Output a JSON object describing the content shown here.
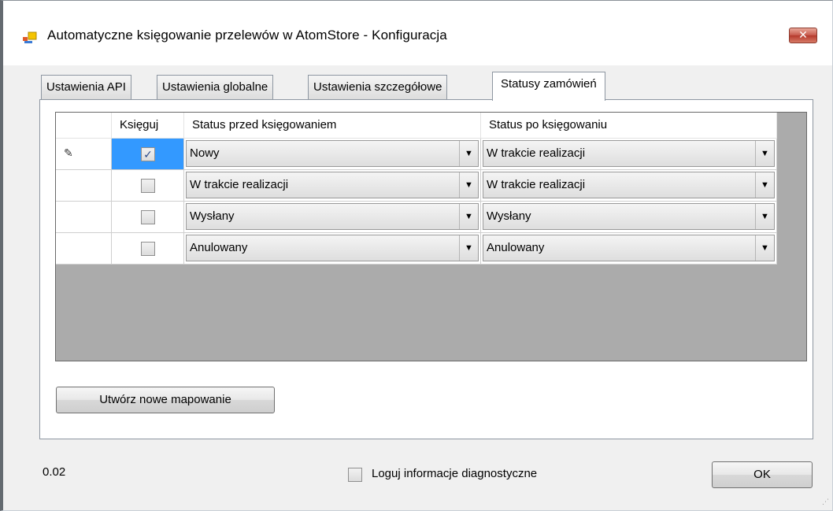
{
  "window": {
    "title": "Automatyczne księgowanie przelewów w AtomStore - Konfiguracja",
    "close_label": "✕"
  },
  "tabs": [
    {
      "label": "Ustawienia API",
      "active": false
    },
    {
      "label": "Ustawienia globalne",
      "active": false
    },
    {
      "label": "Ustawienia szczegółowe",
      "active": false
    },
    {
      "label": "Statusy zamówień",
      "active": true
    }
  ],
  "grid": {
    "columns": [
      "Księguj",
      "Status przed księgowaniem",
      "Status po księgowaniu"
    ],
    "rows": [
      {
        "editing": true,
        "checked": true,
        "before": "Nowy",
        "after": "W trakcie realizacji"
      },
      {
        "editing": false,
        "checked": false,
        "before": "W trakcie realizacji",
        "after": "W trakcie realizacji"
      },
      {
        "editing": false,
        "checked": false,
        "before": "Wysłany",
        "after": "Wysłany"
      },
      {
        "editing": false,
        "checked": false,
        "before": "Anulowany",
        "after": "Anulowany"
      }
    ],
    "edit_glyph": "✎",
    "check_glyph": "✓",
    "dropdown_glyph": "▼"
  },
  "buttons": {
    "create_mapping": "Utwórz nowe mapowanie",
    "ok": "OK"
  },
  "footer": {
    "version": "0.02",
    "diag_label": "Loguj informacje diagnostyczne",
    "diag_checked": false
  },
  "colors": {
    "selection": "#3399ff",
    "grid_background": "#ababab",
    "window_background": "#f0f0f0"
  }
}
